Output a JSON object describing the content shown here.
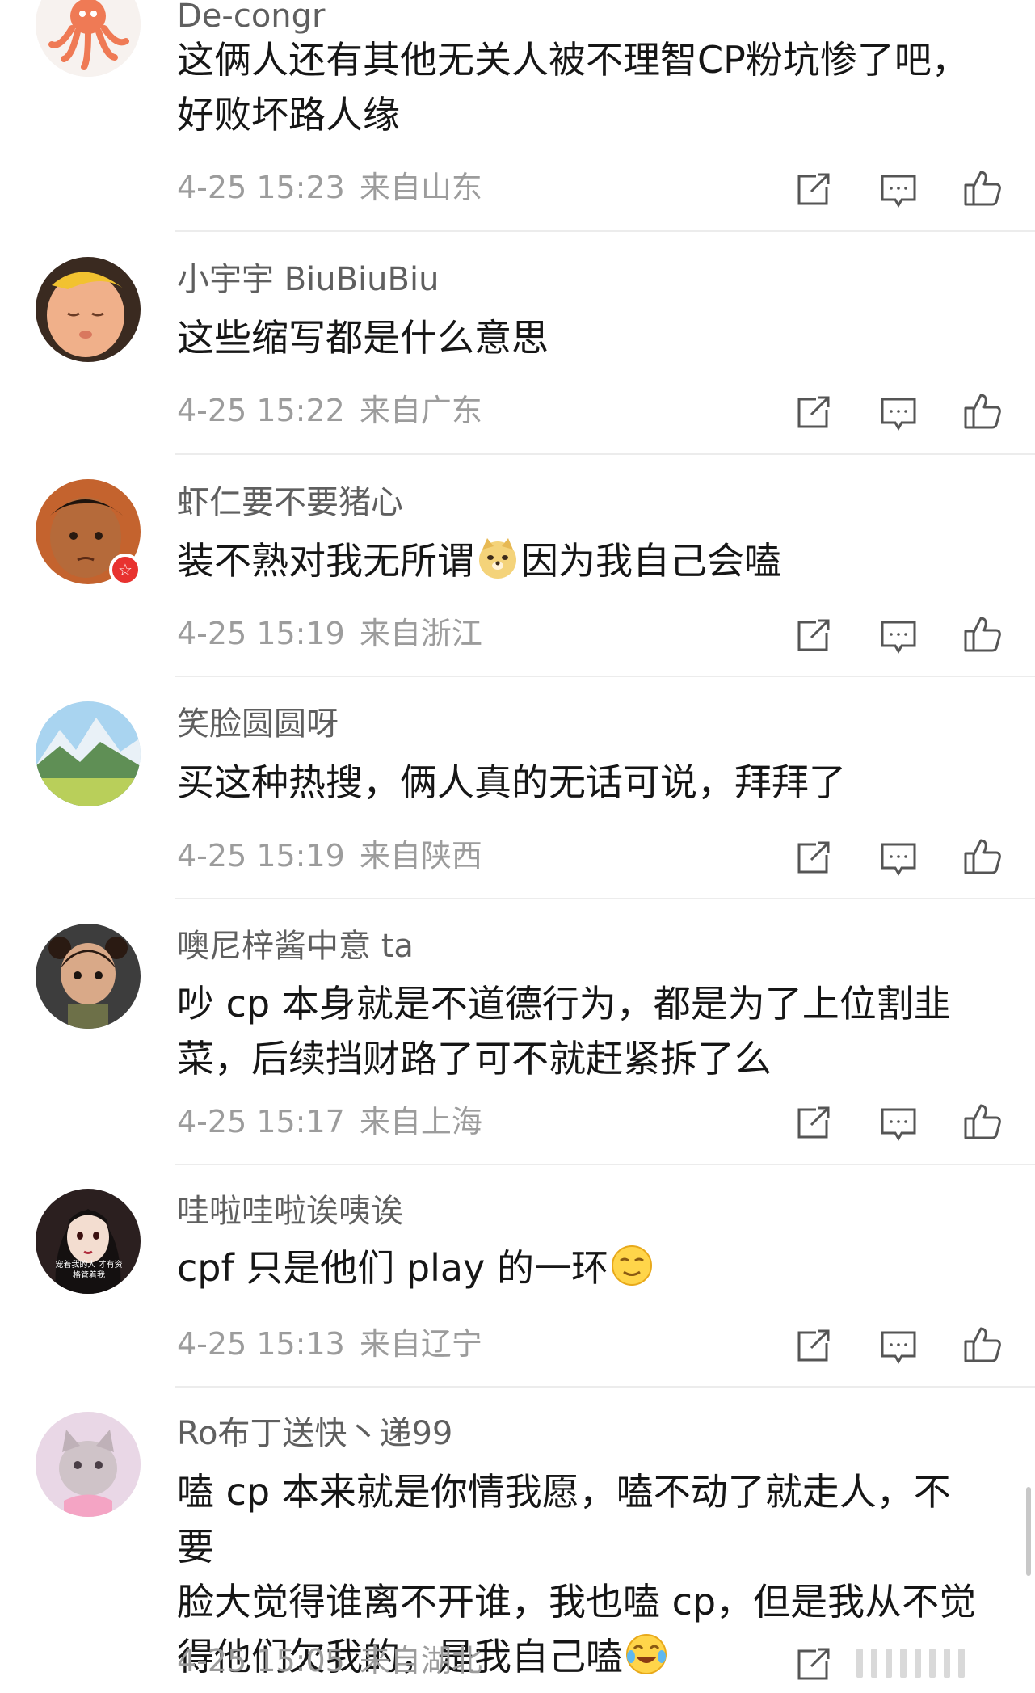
{
  "comments": [
    {
      "user": "De-congr",
      "lines": [
        "这俩人还有其他无关人被不理智CP粉坑惨了吧，",
        "好败坏路人缘"
      ],
      "time": "4-25 15:23",
      "location": "来自山东"
    },
    {
      "user": "小宇宇 BiuBiuBiu",
      "lines": [
        "这些缩写都是什么意思"
      ],
      "time": "4-25 15:22",
      "location": "来自广东"
    },
    {
      "user": "虾仁要不要猪心",
      "text_before": "装不熟对我无所谓",
      "emoji": "doge-emoji",
      "text_after": "因为我自己会嗑",
      "time": "4-25 15:19",
      "location": "来自浙江"
    },
    {
      "user": "笑脸圆圆呀",
      "lines": [
        "买这种热搜，俩人真的无话可说，拜拜了"
      ],
      "time": "4-25 15:19",
      "location": "来自陕西"
    },
    {
      "user": "噢尼梓酱中意 ta",
      "lines": [
        "吵 cp 本身就是不道德行为，都是为了上位割韭",
        "菜，后续挡财路了可不就赶紧拆了么"
      ],
      "time": "4-25 15:17",
      "location": "来自上海"
    },
    {
      "user": "哇啦哇啦诶咦诶",
      "text_before": "cpf 只是他们 play 的一环",
      "emoji": "smirk-emoji",
      "avatar_caption": "宠着我的人 才有资格管着我",
      "time": "4-25 15:13",
      "location": "来自辽宁"
    },
    {
      "user": "Ro布丁送快丶递99",
      "lines": [
        "嗑 cp 本来就是你情我愿，嗑不动了就走人，不要",
        "脸大觉得谁离不开谁，我也嗑 cp，但是我从不觉"
      ],
      "text_before": "得他们欠我的，是我自己嗑",
      "emoji": "laugh-cry-emoji",
      "time": "4-25 15:05",
      "location": "来自湖北"
    }
  ],
  "icons": {
    "share": "share-icon",
    "reply": "comment-icon",
    "like": "thumbs-up-icon"
  },
  "colors": {
    "text": "#161616",
    "username": "#5f5f5f",
    "meta": "#9c9c9c",
    "divider": "#ececec",
    "badge": "#e8322f"
  }
}
